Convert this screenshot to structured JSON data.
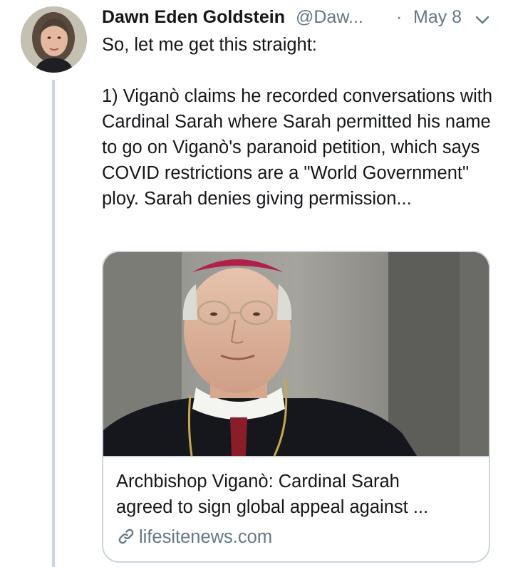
{
  "tweet": {
    "author_name": "Dawn Eden Goldstein",
    "author_handle": "@Daw...",
    "separator": "·",
    "date": "May 8",
    "text_intro": "So, let me get this straight:",
    "text_body": "1) Viganò claims he recorded conversations with Cardinal Sarah where Sarah permitted his name to go on Viganò's paranoid petition, which says COVID restrictions are a \"World Government\" ploy. Sarah denies giving permission...",
    "avatar_icon": "profile-photo",
    "menu_icon": "chevron-down-icon"
  },
  "card": {
    "title_line1": "Archbishop Viganò: Cardinal Sarah",
    "title_line2": "agreed to sign global appeal against ...",
    "domain": "lifesitenews.com",
    "domain_icon": "link-icon"
  },
  "colors": {
    "text": "#14171a",
    "secondary": "#657786",
    "border": "#ccd6dd"
  }
}
